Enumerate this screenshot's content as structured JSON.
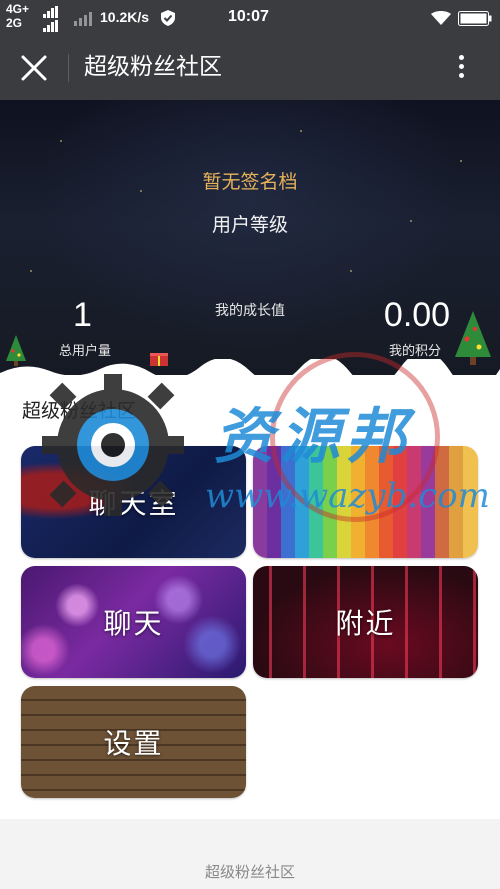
{
  "status_bar": {
    "network_top": "4G+",
    "network_bottom": "2G",
    "speed": "10.2K/s",
    "time": "10:07"
  },
  "nav": {
    "title": "超级粉丝社区",
    "close_icon": "close-icon",
    "more_icon": "more-vertical-icon"
  },
  "profile": {
    "signature": "暂无签名档",
    "level_label": "用户等级",
    "growth_label": "我的成长值",
    "total_users_value": "1",
    "total_users_label": "总用户量",
    "points_value": "0.00",
    "points_label": "我的积分"
  },
  "section": {
    "title": "超级粉丝社区"
  },
  "tiles": [
    {
      "label": "聊天室"
    },
    {
      "label": ""
    },
    {
      "label": "聊天"
    },
    {
      "label": "附近"
    },
    {
      "label": "设置"
    }
  ],
  "footer": {
    "text": "超级粉丝社区"
  },
  "watermark": {
    "title": "资源邦",
    "url": "www.wazyb.com"
  },
  "colors": {
    "nav_bg": "#3a3c3f",
    "signature": "#e7b25a",
    "watermark_blue": "#1f8bd6"
  }
}
